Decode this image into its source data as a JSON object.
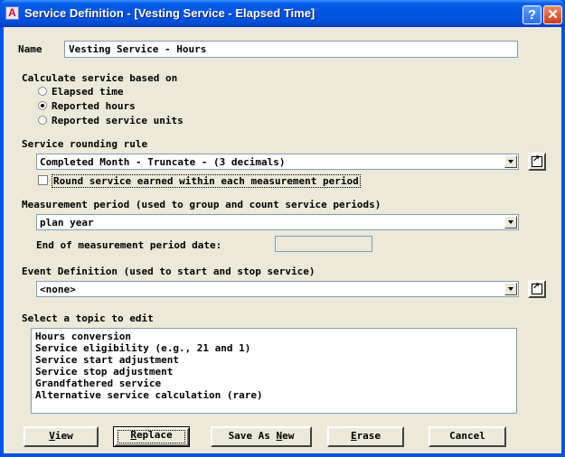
{
  "window": {
    "title": "Service Definition - [Vesting Service - Elapsed Time]",
    "app_icon_letter": "A",
    "help_glyph": "?",
    "close_glyph": "✕"
  },
  "name": {
    "label": "Name",
    "value": "Vesting Service - Hours"
  },
  "calc": {
    "heading": "Calculate service based on",
    "options": [
      {
        "label": "Elapsed time",
        "selected": false
      },
      {
        "label": "Reported hours",
        "selected": true
      },
      {
        "label": "Reported service units",
        "selected": false
      }
    ]
  },
  "rounding": {
    "heading": "Service rounding rule",
    "value": "Completed Month - Truncate - (3 decimals)",
    "checkbox_label": "Round service earned within each measurement period",
    "checked": false
  },
  "measurement": {
    "heading": "Measurement period (used to group and count service periods)",
    "value": "plan year",
    "end_label": "End of measurement period date:",
    "end_value": ""
  },
  "event": {
    "heading": "Event Definition (used to start and stop service)",
    "value": "<none>"
  },
  "topics": {
    "heading": "Select a topic to edit",
    "items": [
      "Hours conversion",
      "Service eligibility (e.g., 21 and 1)",
      "Service start adjustment",
      "Service stop adjustment",
      "Grandfathered service",
      "Alternative service calculation (rare)"
    ]
  },
  "buttons": {
    "view": {
      "ul": "V",
      "rest": "iew"
    },
    "replace": {
      "ul": "R",
      "rest": "eplace"
    },
    "save_as_new": {
      "pre": "Save As ",
      "ul": "N",
      "rest": "ew"
    },
    "erase": {
      "ul": "E",
      "rest": "rase"
    },
    "cancel": {
      "label": "Cancel"
    }
  },
  "colors": {
    "titlebar": "#0054e3",
    "dialog_bg": "#ece9d8",
    "input_border": "#7f9db9"
  }
}
